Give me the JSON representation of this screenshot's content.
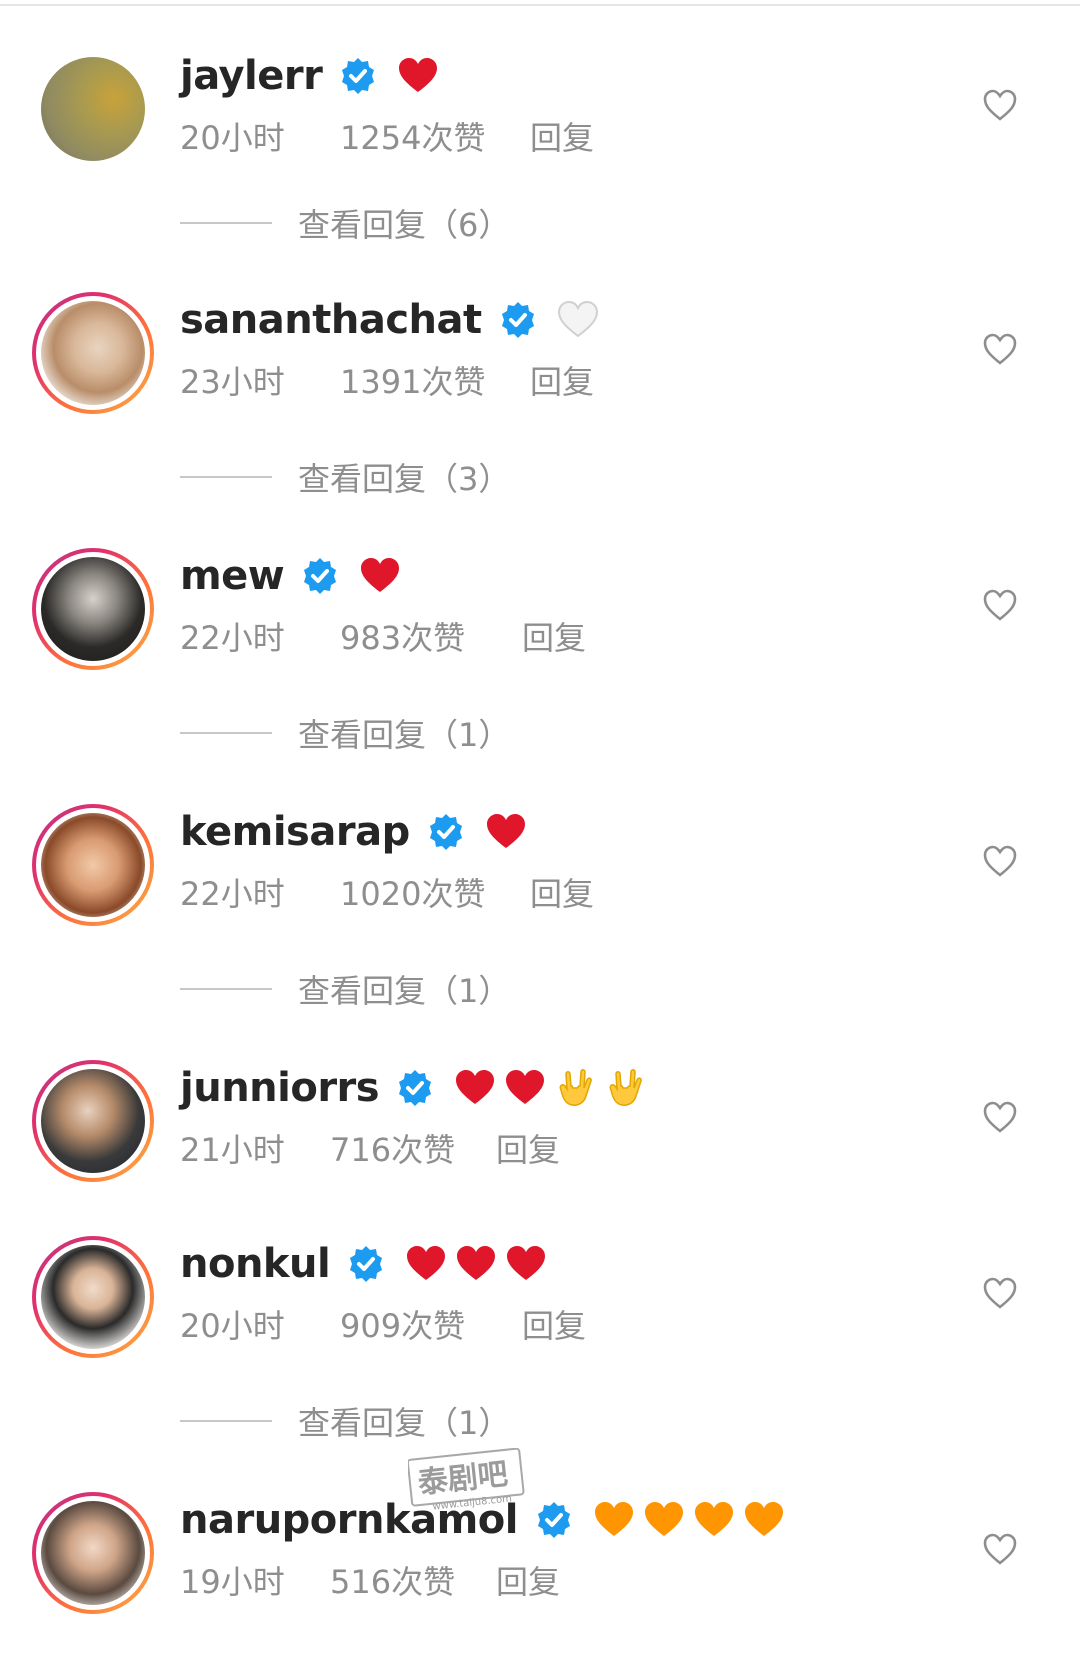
{
  "comments": [
    {
      "username": "jaylerr",
      "emojis": [
        "red-heart"
      ],
      "time": "20小时",
      "likes": "1254次赞",
      "reply": "回复",
      "view_replies": "查看回复（6）",
      "avatar_ring": false
    },
    {
      "username": "sananthachat",
      "emojis": [
        "white-heart"
      ],
      "time": "23小时",
      "likes": "1391次赞",
      "reply": "回复",
      "view_replies": "查看回复（3）",
      "avatar_ring": true
    },
    {
      "username": "mew",
      "emojis": [
        "red-heart"
      ],
      "time": "22小时",
      "likes": "983次赞",
      "reply": "回复",
      "view_replies": "查看回复（1）",
      "avatar_ring": true
    },
    {
      "username": "kemisarap",
      "emojis": [
        "red-heart"
      ],
      "time": "22小时",
      "likes": "1020次赞",
      "reply": "回复",
      "view_replies": "查看回复（1）",
      "avatar_ring": true
    },
    {
      "username": "junniorrs",
      "emojis": [
        "red-heart",
        "red-heart",
        "love-you-gesture",
        "love-you-gesture"
      ],
      "time": "21小时",
      "likes": "716次赞",
      "reply": "回复",
      "view_replies": "",
      "avatar_ring": true
    },
    {
      "username": "nonkul",
      "emojis": [
        "red-heart",
        "red-heart",
        "red-heart"
      ],
      "time": "20小时",
      "likes": "909次赞",
      "reply": "回复",
      "view_replies": "查看回复（1）",
      "avatar_ring": true
    },
    {
      "username": "narupornkamol",
      "emojis": [
        "orange-heart",
        "orange-heart",
        "orange-heart",
        "orange-heart"
      ],
      "time": "19小时",
      "likes": "516次赞",
      "reply": "回复",
      "view_replies": "",
      "avatar_ring": true
    }
  ],
  "watermark": {
    "brand": "泰剧吧",
    "url": "www.taiju8.com"
  },
  "colors": {
    "username": "#262626",
    "meta": "#8e8e8e",
    "verified": "#1d9bf0",
    "red_heart": "#e0162b",
    "orange_heart": "#ff9500",
    "divider": "#c7c7c7"
  }
}
